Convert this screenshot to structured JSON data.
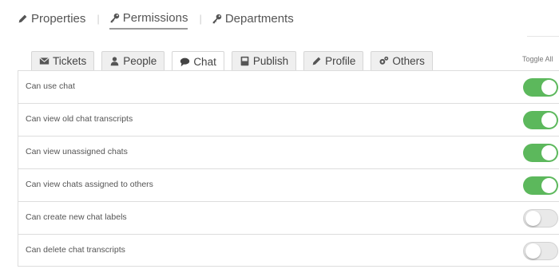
{
  "top_nav": {
    "items": [
      {
        "label": "Properties",
        "icon": "pencil-icon",
        "active": false
      },
      {
        "label": "Permissions",
        "icon": "key-icon",
        "active": true
      },
      {
        "label": "Departments",
        "icon": "key-icon",
        "active": false
      }
    ],
    "separator": "|"
  },
  "tabs": [
    {
      "label": "Tickets",
      "icon": "envelope-icon",
      "active": false
    },
    {
      "label": "People",
      "icon": "user-icon",
      "active": false
    },
    {
      "label": "Chat",
      "icon": "chat-bubble-icon",
      "active": true
    },
    {
      "label": "Publish",
      "icon": "book-icon",
      "active": false
    },
    {
      "label": "Profile",
      "icon": "pencil-icon",
      "active": false
    },
    {
      "label": "Others",
      "icon": "gears-icon",
      "active": false
    }
  ],
  "toggle_all_label": "Toggle All",
  "permissions": [
    {
      "label": "Can use chat",
      "enabled": true
    },
    {
      "label": "Can view old chat transcripts",
      "enabled": true
    },
    {
      "label": "Can view unassigned chats",
      "enabled": true
    },
    {
      "label": "Can view chats assigned to others",
      "enabled": true
    },
    {
      "label": "Can create new chat labels",
      "enabled": false
    },
    {
      "label": "Can delete chat transcripts",
      "enabled": false
    }
  ],
  "colors": {
    "toggle_on": "#5cb85c",
    "toggle_off": "#e9e9e9",
    "text": "#555555"
  }
}
